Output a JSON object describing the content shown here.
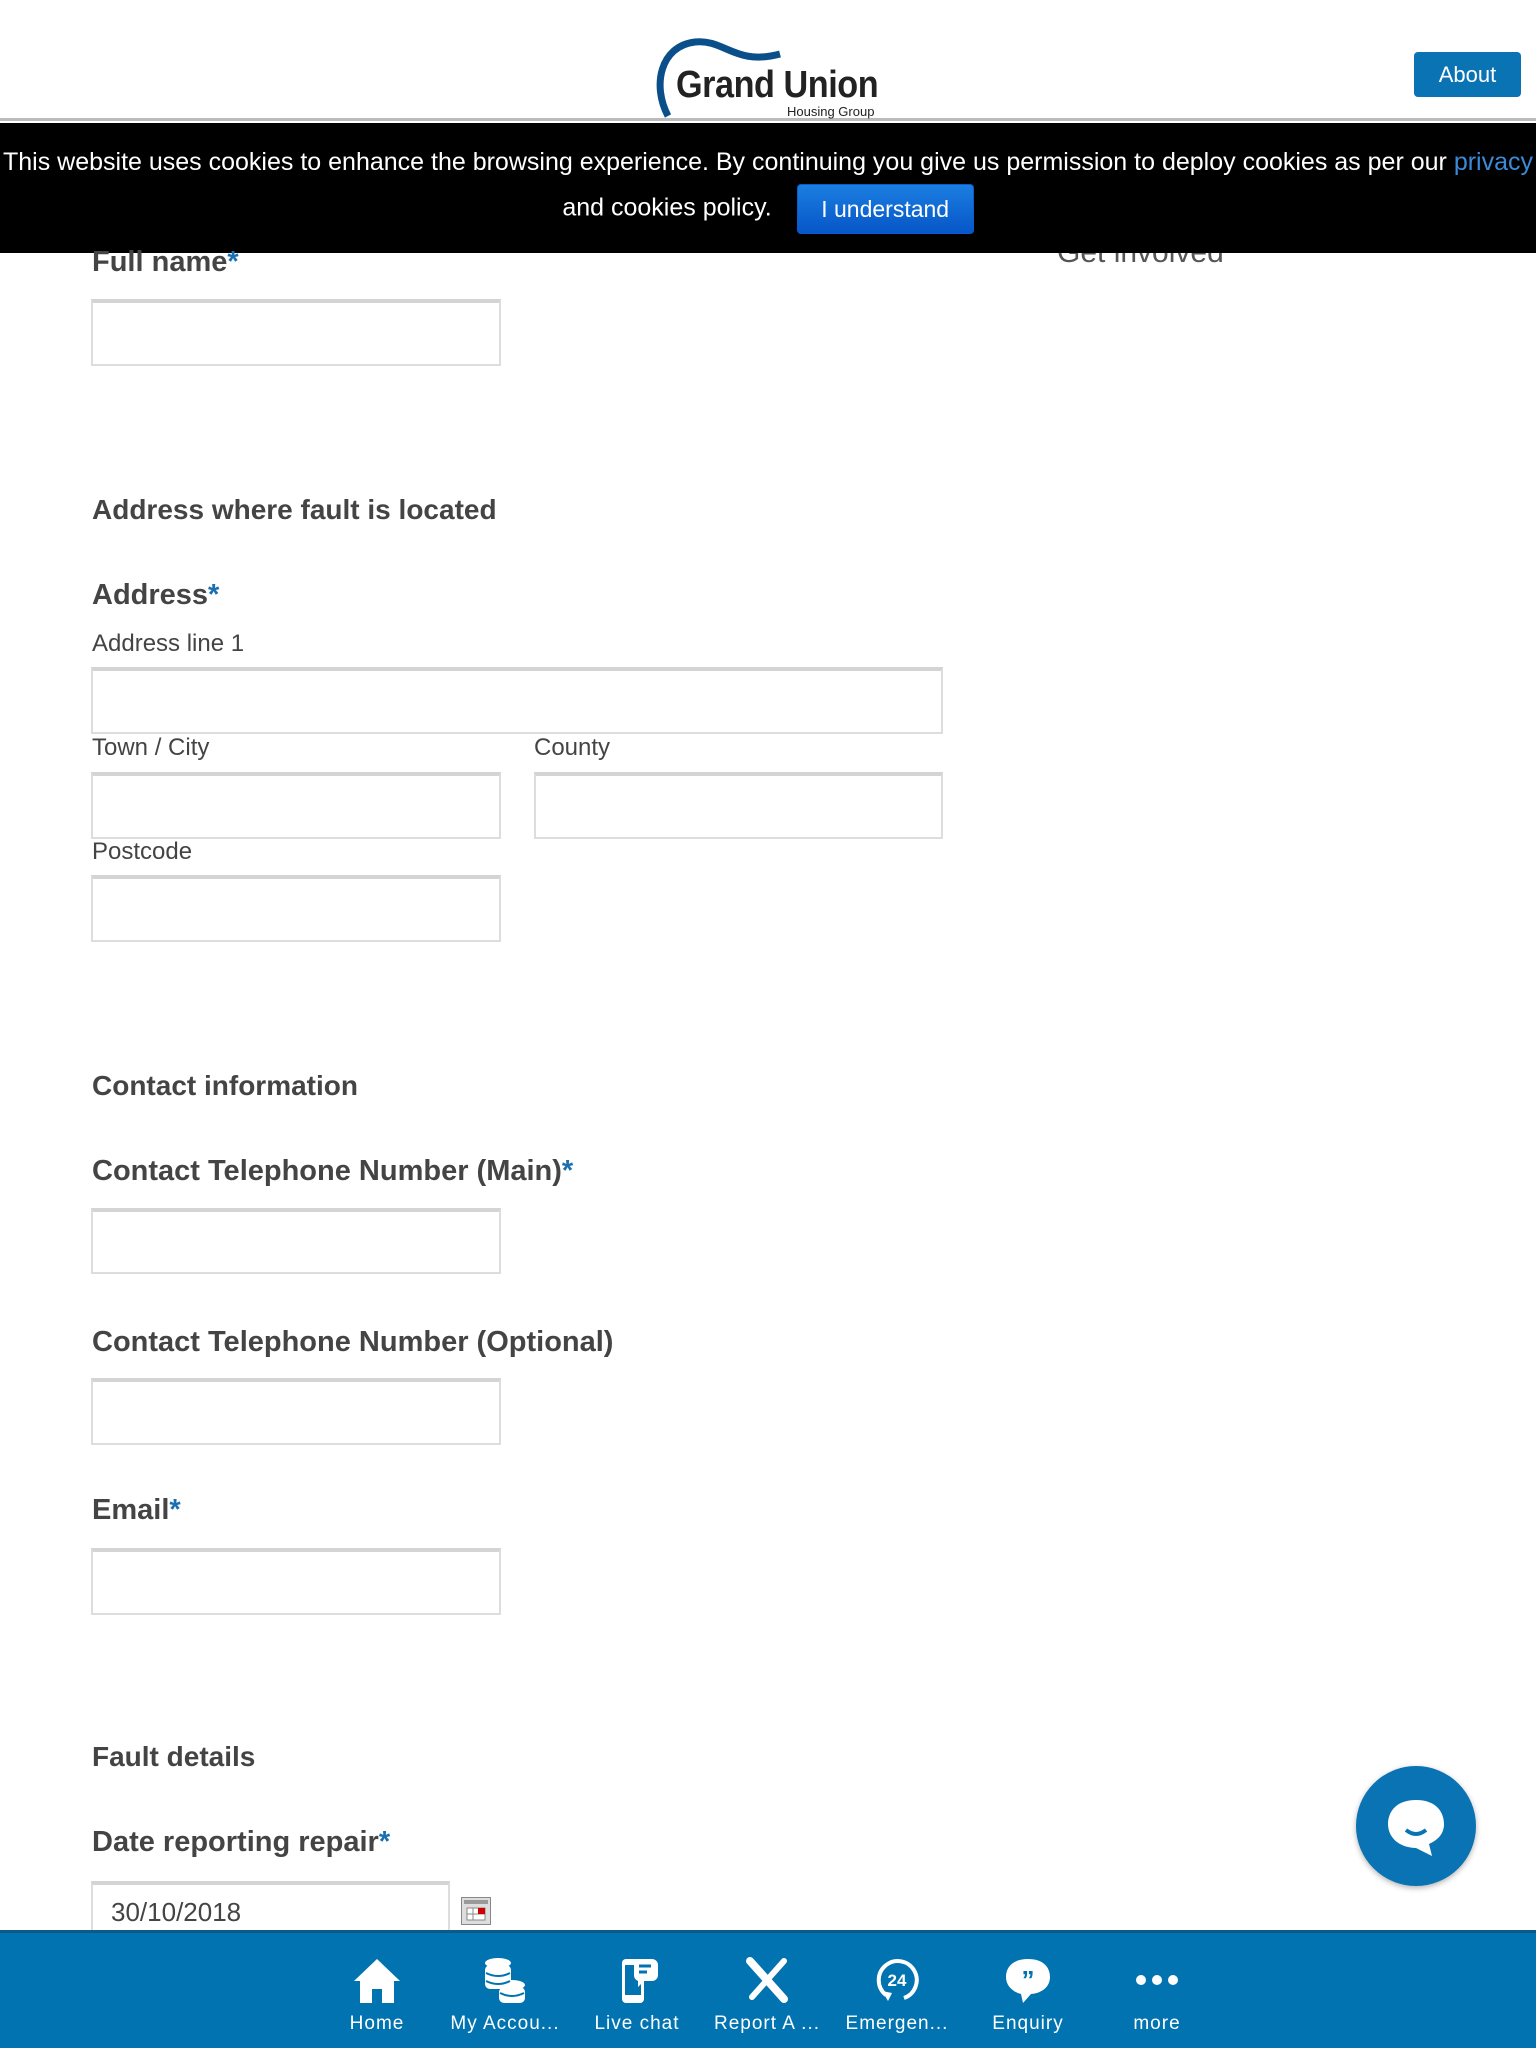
{
  "header": {
    "logo_text": "Grand Union",
    "logo_sub": "Housing Group",
    "about_label": "About"
  },
  "behind_banner": {
    "get_involved": "Get involved"
  },
  "cookie_banner": {
    "text_before": "This website uses cookies to enhance the browsing experience. By continuing you give us permission to deploy cookies as per our",
    "link": "privacy",
    "text_after": "and cookies policy.",
    "button": "I understand"
  },
  "form": {
    "full_name_label": "Full name",
    "required_mark": "*",
    "address_section": "Address where fault is located",
    "address_label": "Address",
    "address_line1": "Address line 1",
    "town": "Town / City",
    "county": "County",
    "postcode": "Postcode",
    "contact_section": "Contact information",
    "tel_main": "Contact Telephone Number (Main)",
    "tel_optional": "Contact Telephone Number (Optional)",
    "email": "Email",
    "fault_section": "Fault details",
    "date_label": "Date reporting repair",
    "date_value": "30/10/2018"
  },
  "nav": {
    "items": [
      {
        "label": "Home",
        "icon": "home-icon"
      },
      {
        "label": "My Accou...",
        "icon": "coins-icon"
      },
      {
        "label": "Live chat",
        "icon": "phone-chat-icon"
      },
      {
        "label": "Report A ...",
        "icon": "tools-icon"
      },
      {
        "label": "Emergen...",
        "icon": "24-hour-icon"
      },
      {
        "label": "Enquiry",
        "icon": "quote-bubble-icon"
      },
      {
        "label": "more",
        "icon": "more-icon"
      }
    ]
  },
  "colors": {
    "brand": "#0a73b4",
    "nav_bg": "#0073b0",
    "banner_bg": "#000000"
  }
}
